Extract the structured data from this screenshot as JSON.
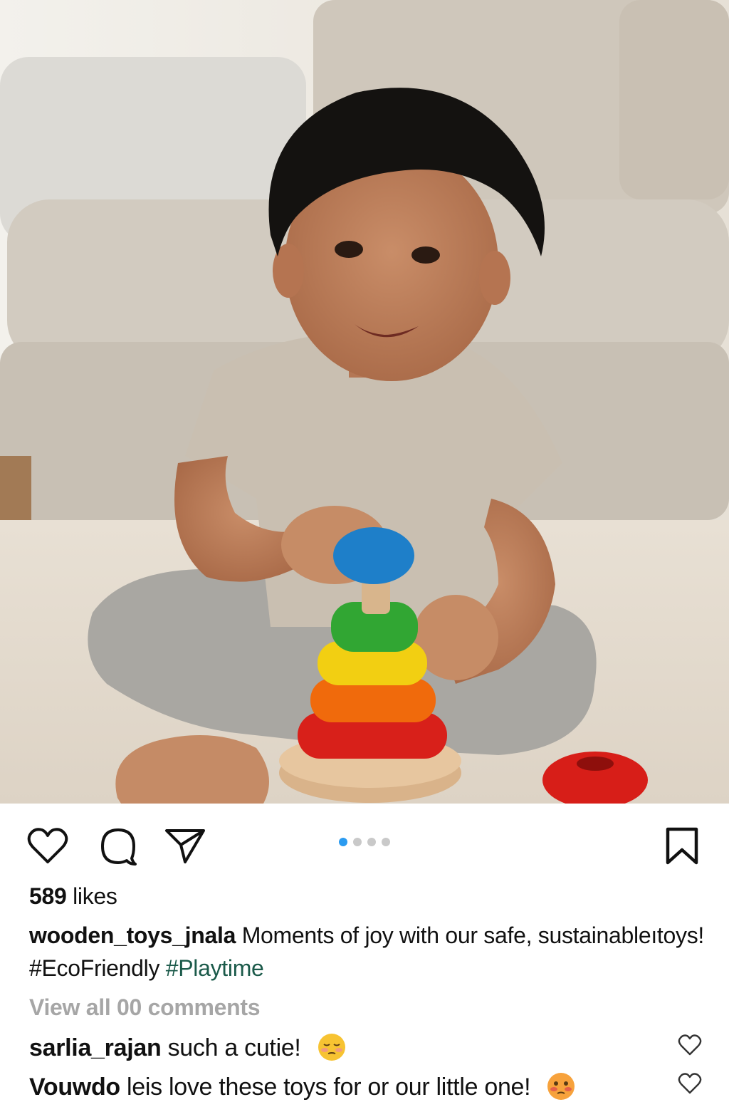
{
  "post": {
    "likes_count": "589",
    "likes_word": "likes",
    "username": "wooden_toys_jnala",
    "caption_text": "Moments of joy with our safe, sustainableıtoys! #EcoFriendly",
    "caption_tag": "#Playtime",
    "view_all_comments": "View all 00 comments",
    "carousel": {
      "total": 4,
      "active_index": 0
    }
  },
  "comments": [
    {
      "user": "sarlia_rajan",
      "text": "such a cutie!",
      "emoji": "blushing-face-emoji"
    },
    {
      "user": "Vouwdo",
      "text": "leis love these toys for or our little one!",
      "emoji": "flushed-face-emoji"
    }
  ],
  "icons": {
    "like": "heart-icon",
    "comment": "comment-bubble-icon",
    "share": "paper-plane-icon",
    "save": "bookmark-icon"
  },
  "colors": {
    "dot_active": "#2b9bf0",
    "dot_inactive": "#c9c9c9",
    "muted_text": "#a6a6a6",
    "hashtag": "#1b5a4a"
  }
}
